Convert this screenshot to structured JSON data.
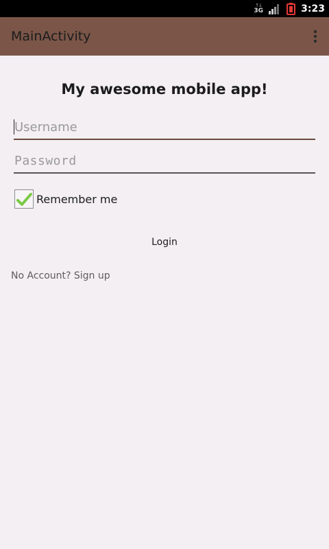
{
  "status_bar": {
    "network_type": "3G",
    "network_arrows": "↑↓",
    "time": "3:23",
    "icons": [
      "network-icon",
      "signal-icon",
      "battery-icon"
    ],
    "battery_color": "#e53935"
  },
  "action_bar": {
    "title": "MainActivity",
    "overflow_icon": "overflow-menu-icon",
    "color": "#7a5548"
  },
  "main": {
    "heading": "My awesome mobile app!",
    "username": {
      "value": "",
      "placeholder": "Username"
    },
    "password": {
      "value": "",
      "placeholder": "Password"
    },
    "remember_me": {
      "label": "Remember me",
      "checked": true
    },
    "login_label": "Login",
    "signup_text": "No Account? Sign up"
  }
}
